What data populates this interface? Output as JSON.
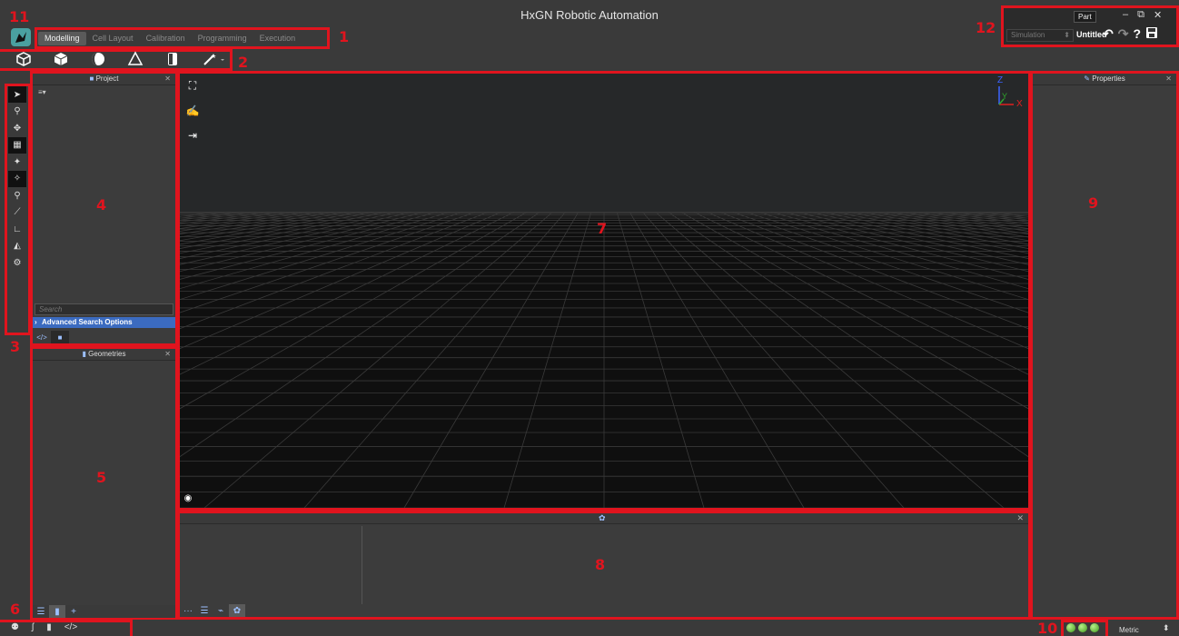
{
  "app": {
    "title": "HxGN Robotic Automation"
  },
  "tabs": [
    {
      "label": "Modelling",
      "active": true
    },
    {
      "label": "Cell Layout",
      "active": false
    },
    {
      "label": "Calibration",
      "active": false
    },
    {
      "label": "Programming",
      "active": false
    },
    {
      "label": "Execution",
      "active": false
    }
  ],
  "corner": {
    "part_tab": "Part",
    "mode_select": "Simulation",
    "document_name": "Untitled"
  },
  "panels": {
    "project": {
      "title": "Project",
      "search_placeholder": "Search",
      "advanced_search": "Advanced Search Options"
    },
    "geometries": {
      "title": "Geometries"
    },
    "properties": {
      "title": "Properties"
    }
  },
  "viewport": {
    "axis_labels": {
      "z": "Z",
      "y": "Y",
      "x": "X"
    }
  },
  "status": {
    "units": "Metric"
  },
  "callouts": [
    "1",
    "2",
    "3",
    "4",
    "5",
    "6",
    "7",
    "8",
    "9",
    "10",
    "11",
    "12"
  ],
  "colors": {
    "accent_red": "#e0141e",
    "selection_blue": "#3b6bc0",
    "status_green": "#5fc12e",
    "logo_teal": "#4aa0a0"
  },
  "icons": {
    "toolbar": [
      "cube-outline-icon",
      "cube-icon",
      "sphere-icon",
      "cone-icon",
      "cylinder-icon",
      "magic-wand-icon"
    ],
    "left_strip": [
      "pointer-icon",
      "select-edges-icon",
      "select-faces-icon",
      "grid-icon",
      "point-icon",
      "pick-icon",
      "location-icon",
      "measure-icon",
      "frame-icon",
      "section-icon",
      "transform-icon"
    ]
  }
}
